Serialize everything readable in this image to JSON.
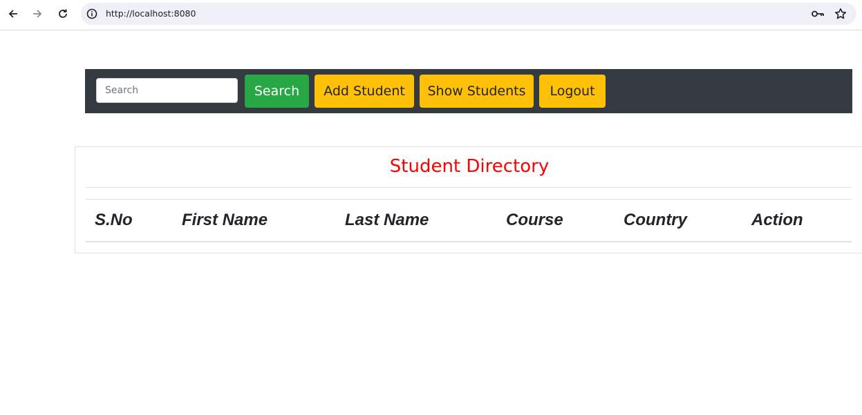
{
  "browser": {
    "url": "http://localhost:8080"
  },
  "navbar": {
    "search_placeholder": "Search",
    "search_value": "",
    "search_button": "Search",
    "add_student_button": "Add Student",
    "show_students_button": "Show Students",
    "logout_button": "Logout"
  },
  "directory": {
    "title": "Student Directory",
    "columns": [
      "S.No",
      "First Name",
      "Last Name",
      "Course",
      "Country",
      "Action"
    ],
    "rows": []
  },
  "colors": {
    "navbar_bg": "#343a40",
    "success": "#28a745",
    "warning": "#ffc107",
    "title": "#ff0000"
  }
}
